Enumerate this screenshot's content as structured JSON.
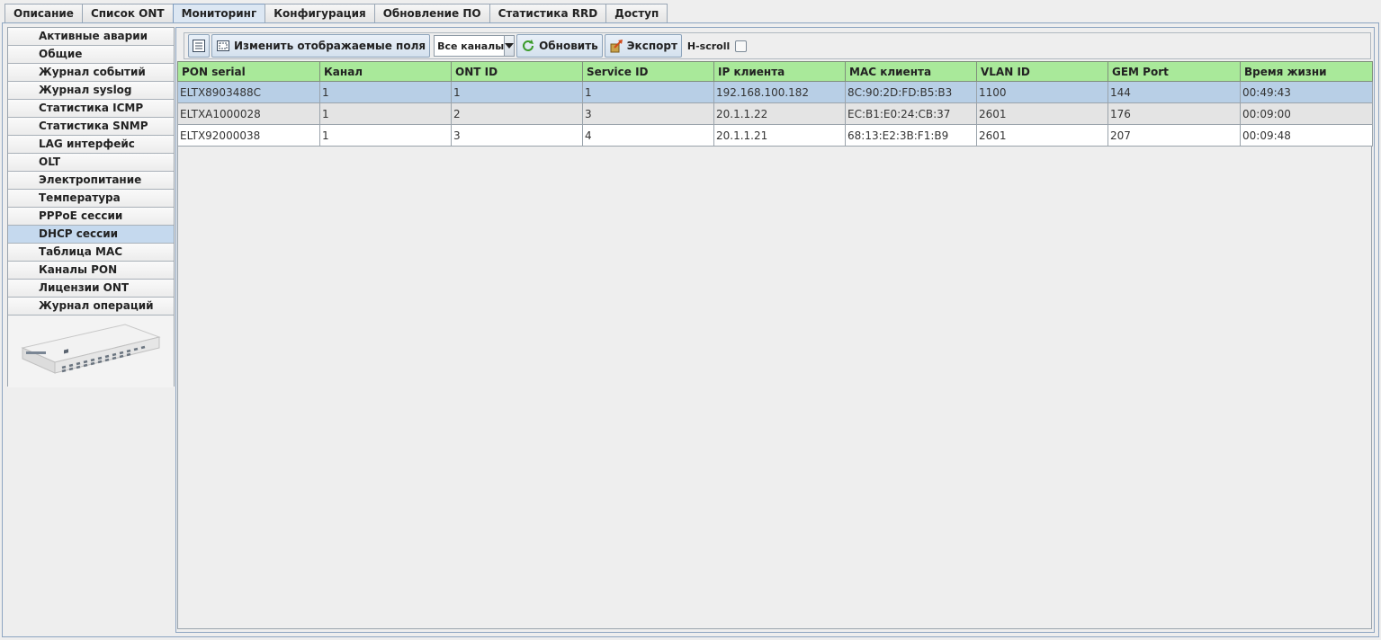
{
  "top_tabs": [
    {
      "label": "Описание"
    },
    {
      "label": "Список ONT"
    },
    {
      "label": "Мониторинг",
      "active": true
    },
    {
      "label": "Конфигурация"
    },
    {
      "label": "Обновление ПО"
    },
    {
      "label": "Статистика RRD"
    },
    {
      "label": "Доступ"
    }
  ],
  "sidebar": {
    "items": [
      {
        "label": "Активные аварии"
      },
      {
        "label": "Общие"
      },
      {
        "label": "Журнал событий"
      },
      {
        "label": "Журнал syslog"
      },
      {
        "label": "Статистика ICMP"
      },
      {
        "label": "Статистика SNMP"
      },
      {
        "label": "LAG интерфейс"
      },
      {
        "label": "OLT"
      },
      {
        "label": "Электропитание"
      },
      {
        "label": "Температура"
      },
      {
        "label": "PPPoE сессии"
      },
      {
        "label": "DHCP сессии",
        "active": true
      },
      {
        "label": "Таблица MAC"
      },
      {
        "label": "Каналы PON"
      },
      {
        "label": "Лицензии ONT"
      },
      {
        "label": "Журнал операций"
      }
    ]
  },
  "toolbar": {
    "change_fields_label": "Изменить отображаемые поля",
    "channel_select_value": "Все каналы",
    "refresh_label": "Обновить",
    "export_label": "Экспорт",
    "hscroll_label": "H-scroll"
  },
  "table": {
    "columns": [
      "PON serial",
      "Канал",
      "ONT ID",
      "Service ID",
      "IP клиента",
      "MAC клиента",
      "VLAN ID",
      "GEM Port",
      "Время жизни"
    ],
    "rows": [
      [
        "ELTX8903488C",
        "1",
        "1",
        "1",
        "192.168.100.182",
        "8C:90:2D:FD:B5:B3",
        "1100",
        "144",
        "00:49:43"
      ],
      [
        "ELTXA1000028",
        "1",
        "2",
        "3",
        "20.1.1.22",
        "EC:B1:E0:24:CB:37",
        "2601",
        "176",
        "00:09:00"
      ],
      [
        "ELTX92000038",
        "1",
        "3",
        "4",
        "20.1.1.21",
        "68:13:E2:3B:F1:B9",
        "2601",
        "207",
        "00:09:48"
      ]
    ]
  },
  "colors": {
    "header_green": "#a9e99a",
    "selected_row": "#b8cfe6",
    "active_tab": "#dce7f3"
  }
}
